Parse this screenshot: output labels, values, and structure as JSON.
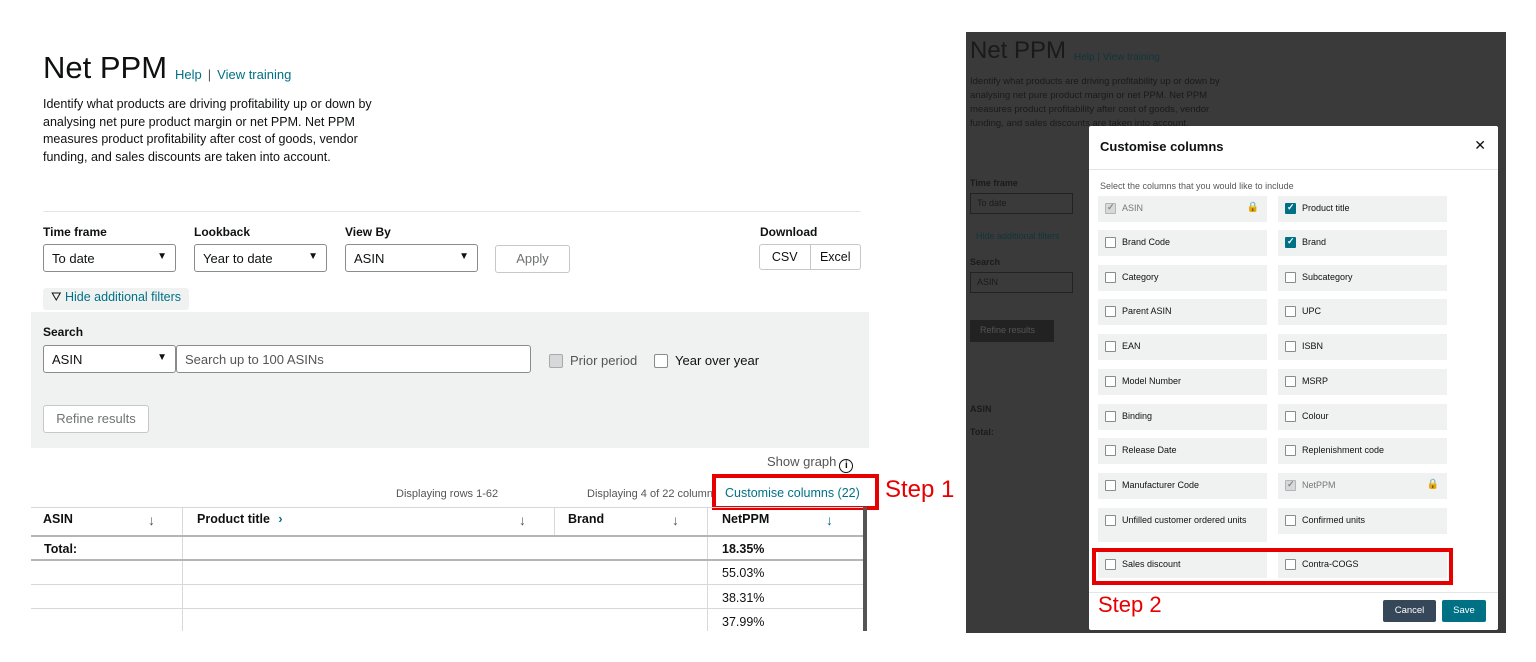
{
  "left": {
    "title": "Net PPM",
    "help": "Help",
    "separator": "|",
    "training": "View training",
    "description": "Identify what products are driving profitability up or down by analysing net pure product margin or net PPM. Net PPM measures product profitability after cost of goods, vendor funding, and sales discounts are taken into account.",
    "timeframe_label": "Time frame",
    "timeframe_value": "To date",
    "lookback_label": "Lookback",
    "lookback_value": "Year to date",
    "viewby_label": "View By",
    "viewby_value": "ASIN",
    "apply": "Apply",
    "download_label": "Download",
    "csv": "CSV",
    "excel": "Excel",
    "hide_filters": "Hide additional filters",
    "search_label": "Search",
    "search_type": "ASIN",
    "search_placeholder": "Search up to 100 ASINs",
    "prior_period": "Prior period",
    "year_over_year": "Year over year",
    "refine": "Refine results",
    "show_graph": "Show graph",
    "displaying_rows": "Displaying rows 1-62",
    "displaying_cols": "Displaying 4 of 22 columns",
    "customise": "Customise columns (22)",
    "step1": "Step 1",
    "columns": [
      "ASIN",
      "Product title",
      "Brand",
      "NetPPM"
    ],
    "total_label": "Total:",
    "netppm_values": [
      "18.35%",
      "55.03%",
      "38.31%",
      "37.99%"
    ]
  },
  "right": {
    "bg_title": "Net PPM",
    "bg_help": "Help",
    "bg_training": "View training",
    "bg_desc": "Identify what products are driving profitability up or down by analysing net pure product margin or net PPM. Net PPM measures product profitability after cost of goods, vendor funding, and sales discounts are taken into account.",
    "bg_timeframe": "Time frame",
    "bg_todate": "To date",
    "bg_hide": "Hide additional filters",
    "bg_search": "Search",
    "bg_asin": "ASIN",
    "bg_refine": "Refine results",
    "bg_col_asin": "ASIN",
    "bg_total": "Total:",
    "modal_title": "Customise columns",
    "modal_sub": "Select the columns that you would like to include",
    "options_left": [
      {
        "label": "ASIN",
        "state": "locked"
      },
      {
        "label": "Brand Code",
        "state": "off"
      },
      {
        "label": "Category",
        "state": "off"
      },
      {
        "label": "Parent ASIN",
        "state": "off"
      },
      {
        "label": "EAN",
        "state": "off"
      },
      {
        "label": "Model Number",
        "state": "off"
      },
      {
        "label": "Binding",
        "state": "off"
      },
      {
        "label": "Release Date",
        "state": "off"
      },
      {
        "label": "Manufacturer Code",
        "state": "off"
      },
      {
        "label": "Unfilled customer ordered units",
        "state": "off"
      },
      {
        "label": "Sales discount",
        "state": "off"
      }
    ],
    "options_right": [
      {
        "label": "Product title",
        "state": "on"
      },
      {
        "label": "Brand",
        "state": "on"
      },
      {
        "label": "Subcategory",
        "state": "off"
      },
      {
        "label": "UPC",
        "state": "off"
      },
      {
        "label": "ISBN",
        "state": "off"
      },
      {
        "label": "MSRP",
        "state": "off"
      },
      {
        "label": "Colour",
        "state": "off"
      },
      {
        "label": "Replenishment code",
        "state": "off"
      },
      {
        "label": "NetPPM",
        "state": "locked"
      },
      {
        "label": "Confirmed units",
        "state": "off"
      },
      {
        "label": "Contra-COGS",
        "state": "off"
      }
    ],
    "cancel": "Cancel",
    "save": "Save",
    "step2": "Step 2"
  },
  "colors": {
    "link": "#007185",
    "highlight": "#e60000",
    "cancel_btn": "#37475a",
    "save_btn": "#007185",
    "overlay": "#3a3a3a"
  },
  "icons": {
    "dropdown": "chevron-down-icon",
    "filter": "filter-icon",
    "info": "info-icon",
    "sort": "arrow-down-icon",
    "expand": "chevron-right-icon",
    "lock": "lock-icon",
    "close": "close-icon",
    "check": "check-icon"
  }
}
